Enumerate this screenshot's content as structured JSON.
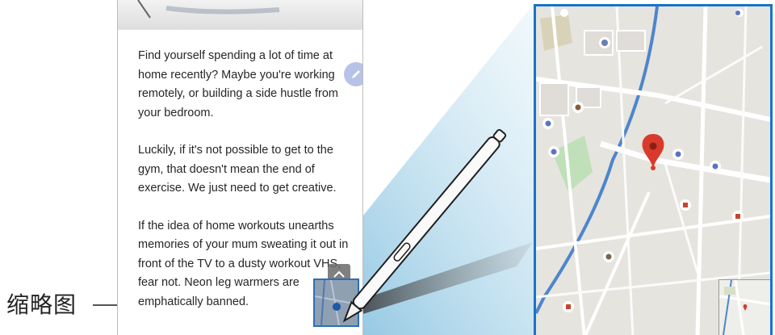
{
  "callout": {
    "label": "缩略图"
  },
  "article": {
    "paragraphs": [
      "Find yourself spending a lot of time at\nhome recently? Maybe you're working\nremotely, or building a side hustle from\nyour bedroom.",
      "Luckily, if it's not possible to get to the\ngym, that doesn't mean the end of\nexercise. We just need to get creative.",
      "If the idea of home workouts unearths\nmemories of your mum sweating it out in\nfront of the TV to a dusty workout VHS,\nfear not. Neon leg warmers are\nemphatically banned."
    ]
  },
  "icons": {
    "pen_fab": "pencil-icon",
    "scroll_up": "chevron-up-icon",
    "map_pin": "location-pin-icon"
  },
  "colors": {
    "accent": "#1a73c9",
    "fab": "#b8c2e8",
    "pin": "#d83b2b",
    "beam": "#a9d4ea"
  }
}
